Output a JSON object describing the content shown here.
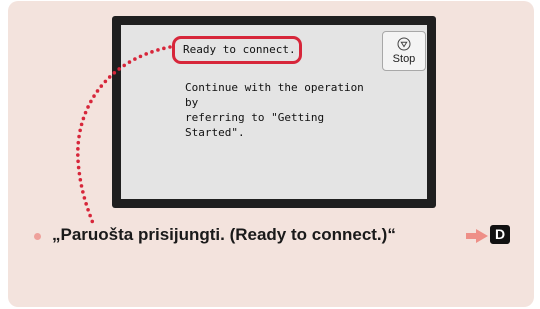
{
  "screen": {
    "message_title": "Ready to connect.",
    "message_body": "Continue with the operation by\nreferring to \"Getting Started\".",
    "stop_button": {
      "label": "Stop",
      "icon": "stop-circle-icon"
    }
  },
  "caption": {
    "text": "„Paruošta prisijungti. (Ready to connect.)“",
    "badge": "D",
    "arrow_icon": "right-arrow-icon"
  },
  "colors": {
    "panel_bg": "#f3e3dd",
    "highlight": "#d7263a",
    "arrow": "#ee8f87",
    "bullet": "#eea19b",
    "screen_bg": "#e4e4e4",
    "frame": "#1f1f1f"
  }
}
